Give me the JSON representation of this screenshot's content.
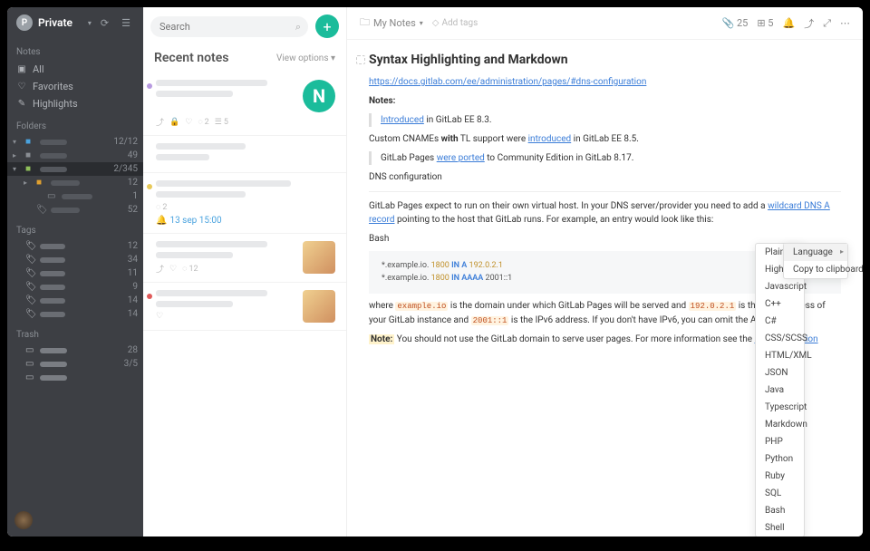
{
  "workspace": {
    "letter": "P",
    "name": "Private"
  },
  "sidebar": {
    "sections": {
      "notes": "Notes",
      "folders": "Folders",
      "tags": "Tags",
      "trash": "Trash"
    },
    "nav": [
      {
        "icon": "grid-icon",
        "label": "All"
      },
      {
        "icon": "heart-icon",
        "label": "Favorites"
      },
      {
        "icon": "highlight-icon",
        "label": "Highlights"
      }
    ],
    "folders": [
      {
        "type": "folder",
        "color": "#4aa3df",
        "count": "12/12",
        "indent": 0,
        "expanded": true
      },
      {
        "type": "folder",
        "color": "#8a8e94",
        "count": "49",
        "indent": 0,
        "expanded": false
      },
      {
        "type": "folder",
        "color": "#8fbf5a",
        "count": "2/345",
        "indent": 0,
        "expanded": true,
        "selected": true
      },
      {
        "type": "folder",
        "color": "#e0a030",
        "count": "12",
        "indent": 1,
        "expanded": false
      },
      {
        "type": "file",
        "color": "#8a8e94",
        "count": "1",
        "indent": 2
      },
      {
        "type": "tagged",
        "color": "#8a8e94",
        "count": "52",
        "indent": 1
      }
    ],
    "tags": [
      {
        "count": "12"
      },
      {
        "count": "34"
      },
      {
        "count": "11"
      },
      {
        "count": "9"
      },
      {
        "count": "14"
      },
      {
        "count": "14"
      }
    ],
    "trash": [
      {
        "count": "28"
      },
      {
        "count": "3/5"
      },
      {
        "count": ""
      }
    ]
  },
  "middle": {
    "search_ph": "Search",
    "title": "Recent notes",
    "view_opts": "View options",
    "cards": [
      {
        "dot": "#b89ae0",
        "meta_comments": "2",
        "meta_list": "5",
        "thumb": "N"
      },
      {
        "dot": null,
        "single": true
      },
      {
        "dot": "#e8c95a",
        "meta_comments": "2",
        "reminder": "13 sep 15:00"
      },
      {
        "dot": null,
        "thumb": "food",
        "meta_comments": "12"
      },
      {
        "dot": "#e05a5a",
        "thumb": "food",
        "heart": true
      }
    ]
  },
  "content": {
    "breadcrumb": "My Notes",
    "add_tags": "Add tags",
    "attach_count": "25",
    "col_count": "5",
    "title": "Syntax Highlighting and Markdown",
    "link1": "https://docs.gitlab.com/ee/administration/pages/#dns-configuration",
    "notes_label": "Notes:",
    "bq1_link": "Introduced",
    "bq1_rest": " in GitLab EE 8.3.",
    "p1_a": "Custom    CNAMEs ",
    "p1_b": "with",
    "p1_c": "  TL support were ",
    "p1_link": "introduced",
    "p1_d": " in GitLab EE 8.5.",
    "bq2_a": "GitLab Pages ",
    "bq2_link": "were ported",
    "bq2_b": " to Community Edition in GitLab 8.17.",
    "p2": "DNS configuration",
    "p3_a": "GitLab Pages expect to run  on  their own virtual host. In your DNS server/provider you need to add a ",
    "p3_link": "wildcard DNS A record",
    "p3_b": " pointing to the host that GitLab runs. For example, an entry would look like this:",
    "code_lang": "Bash",
    "code_l1_a": "*.example.io. ",
    "code_l1_b": "1800",
    "code_l1_c": " IN ",
    "code_l1_d": "A ",
    "code_l1_e": "192.0.2.1",
    "code_l2_a": "*.example.io. ",
    "code_l2_b": "1800",
    "code_l2_c": " IN ",
    "code_l2_d": "AAAA ",
    "code_l2_e": "2001::1",
    "p4_a": "where ",
    "p4_c1": "example.io",
    "p4_b": " is the domain under which GitLab Pages will be served and ",
    "p4_c2": "192.0.2.1",
    "p4_c": " is the IPv4 address of your GitLab instance and ",
    "p4_c3": "2001::1",
    "p4_d": " is the IPv6 address. If you don't have IPv6, you can omit the AAAA record.",
    "p5_note": "Note:",
    "p5_a": " You should not use the GitLab domain to serve user pages. For more information see the ",
    "p5_link": "security section"
  },
  "ctx1": {
    "items": [
      "Plain Text",
      "Highlight",
      "Javascript",
      "C++",
      "C#",
      "CSS/SCSS",
      "HTML/XML",
      "JSON",
      "Java",
      "Typescript",
      "Markdown",
      "PHP",
      "Python",
      "Ruby",
      "SQL",
      "Bash",
      "Shell"
    ]
  },
  "ctx2": {
    "items": [
      "Language",
      "Copy to clipboard"
    ]
  }
}
